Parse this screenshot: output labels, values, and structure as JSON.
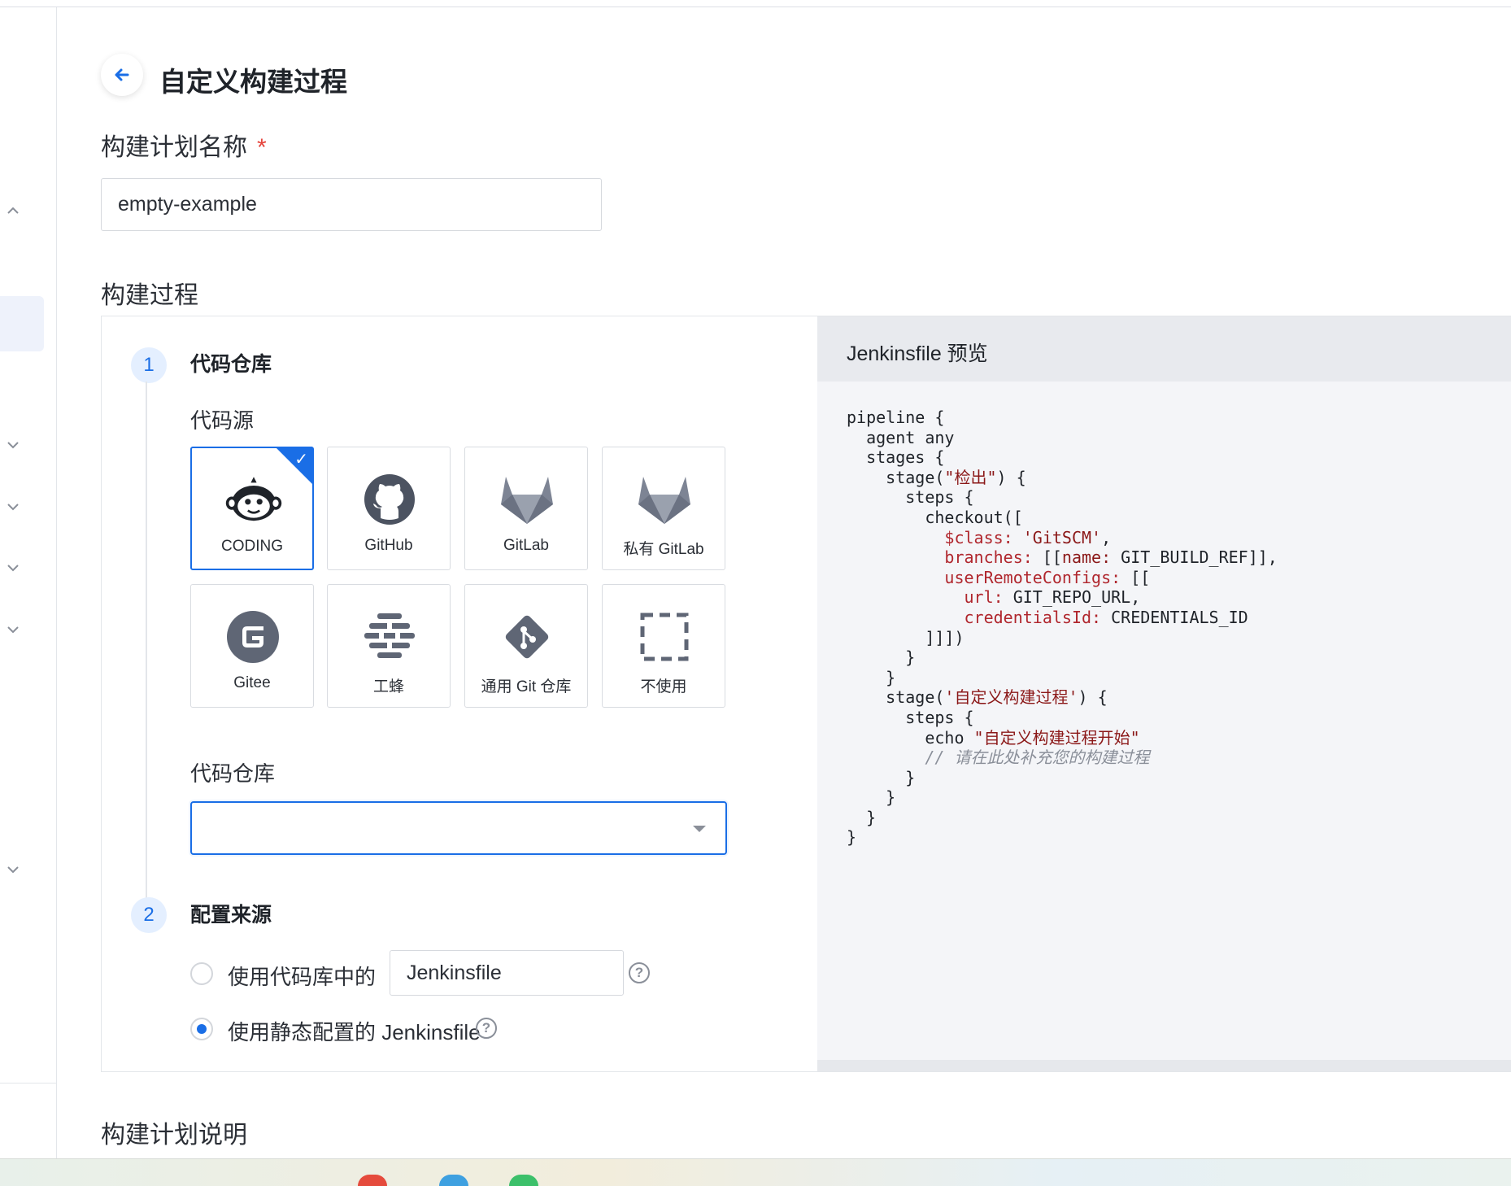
{
  "page": {
    "title": "自定义构建过程",
    "name_label": "构建计划名称",
    "required_mark": "*",
    "name_value": "empty-example",
    "process_label": "构建过程",
    "description_label": "构建计划说明"
  },
  "steps": [
    {
      "number": "1",
      "title": "代码仓库"
    },
    {
      "number": "2",
      "title": "配置来源"
    }
  ],
  "code_source": {
    "label": "代码源",
    "selected": "CODING",
    "options": [
      {
        "label": "CODING",
        "icon": "coding-monkey-icon"
      },
      {
        "label": "GitHub",
        "icon": "github-icon"
      },
      {
        "label": "GitLab",
        "icon": "gitlab-icon"
      },
      {
        "label": "私有 GitLab",
        "icon": "gitlab-icon"
      },
      {
        "label": "Gitee",
        "icon": "gitee-icon"
      },
      {
        "label": "工蜂",
        "icon": "gongfeng-icon"
      },
      {
        "label": "通用 Git 仓库",
        "icon": "git-icon"
      },
      {
        "label": "不使用",
        "icon": "dashed-square-icon"
      }
    ]
  },
  "repo": {
    "label": "代码仓库",
    "value": ""
  },
  "config_source": {
    "option1_label": "使用代码库中的",
    "option1_input": "Jenkinsfile",
    "option2_label": "使用静态配置的 Jenkinsfile",
    "selected": "option2"
  },
  "preview": {
    "title": "Jenkinsfile 预览"
  },
  "colors": {
    "accent": "#1a6ee6",
    "required": "#e5453d",
    "preview_bg": "#f4f5f8"
  }
}
